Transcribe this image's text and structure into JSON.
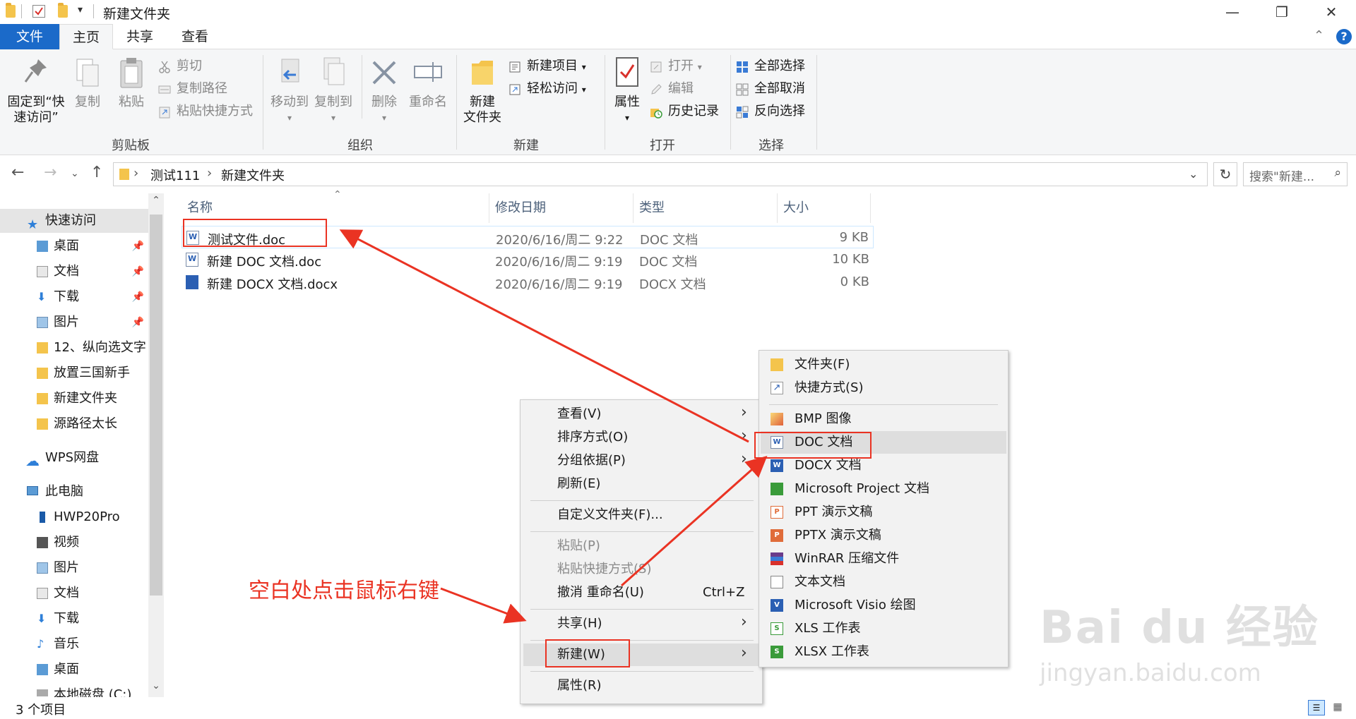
{
  "window": {
    "title": "新建文件夹",
    "minimize": "—",
    "maximize": "❐",
    "close": "✕"
  },
  "tabs": {
    "file": "文件",
    "home": "主页",
    "share": "共享",
    "view": "查看"
  },
  "ribbon": {
    "clipboard": {
      "group_label": "剪贴板",
      "pin_line1": "固定到“快",
      "pin_line2": "速访问”",
      "copy": "复制",
      "paste": "粘贴",
      "cut": "剪切",
      "copy_path": "复制路径",
      "paste_shortcut": "粘贴快捷方式"
    },
    "organize": {
      "group_label": "组织",
      "move_to": "移动到",
      "copy_to": "复制到",
      "delete": "删除",
      "rename": "重命名"
    },
    "new": {
      "group_label": "新建",
      "new_folder_line1": "新建",
      "new_folder_line2": "文件夹",
      "new_item": "新建项目",
      "easy_access": "轻松访问"
    },
    "open": {
      "group_label": "打开",
      "properties": "属性",
      "open": "打开",
      "edit": "编辑",
      "history": "历史记录"
    },
    "select": {
      "group_label": "选择",
      "select_all": "全部选择",
      "select_none": "全部取消",
      "invert": "反向选择"
    }
  },
  "address": {
    "crumbs": [
      "测试111",
      "新建文件夹"
    ],
    "search_placeholder": "搜索\"新建...",
    "refresh_glyph": "↻"
  },
  "sidebar": {
    "quick_access": "快速访问",
    "quick_items": [
      "桌面",
      "文档",
      "下载",
      "图片",
      "12、纵向选文字",
      "放置三国新手",
      "新建文件夹",
      "源路径太长"
    ],
    "wps": "WPS网盘",
    "this_pc": "此电脑",
    "pc_items": [
      "HWP20Pro",
      "视频",
      "图片",
      "文档",
      "下载",
      "音乐",
      "桌面",
      "本地磁盘 (C:)"
    ]
  },
  "filelist": {
    "columns": [
      "名称",
      "修改日期",
      "类型",
      "大小"
    ],
    "rows": [
      {
        "name": "测试文件.doc",
        "date": "2020/6/16/周二 9:22",
        "type": "DOC 文档",
        "size": "9 KB"
      },
      {
        "name": "新建 DOC 文档.doc",
        "date": "2020/6/16/周二 9:19",
        "type": "DOC 文档",
        "size": "10 KB"
      },
      {
        "name": "新建 DOCX 文档.docx",
        "date": "2020/6/16/周二 9:19",
        "type": "DOCX 文档",
        "size": "0 KB"
      }
    ]
  },
  "status": {
    "count": "3 个项目"
  },
  "context_menu": {
    "view": "查看(V)",
    "sort": "排序方式(O)",
    "group": "分组依据(P)",
    "refresh": "刷新(E)",
    "customize": "自定义文件夹(F)...",
    "paste": "粘贴(P)",
    "paste_shortcut": "粘贴快捷方式(S)",
    "undo": "撤消 重命名(U)",
    "undo_shortcut": "Ctrl+Z",
    "share": "共享(H)",
    "new": "新建(W)",
    "properties": "属性(R)"
  },
  "new_submenu": {
    "items": [
      "文件夹(F)",
      "快捷方式(S)",
      "BMP 图像",
      "DOC 文档",
      "DOCX 文档",
      "Microsoft Project 文档",
      "PPT 演示文稿",
      "PPTX 演示文稿",
      "WinRAR 压缩文件",
      "文本文档",
      "Microsoft Visio 绘图",
      "XLS 工作表",
      "XLSX 工作表"
    ]
  },
  "annotation": {
    "text": "空白处点击鼠标右键",
    "color": "#ea3323"
  },
  "watermark": {
    "main": "Bai du 经验",
    "sub": "jingyan.baidu.com"
  },
  "colors": {
    "accent": "#1b6ac9",
    "highlight_red": "#ea3323",
    "folder": "#f4c44c"
  }
}
